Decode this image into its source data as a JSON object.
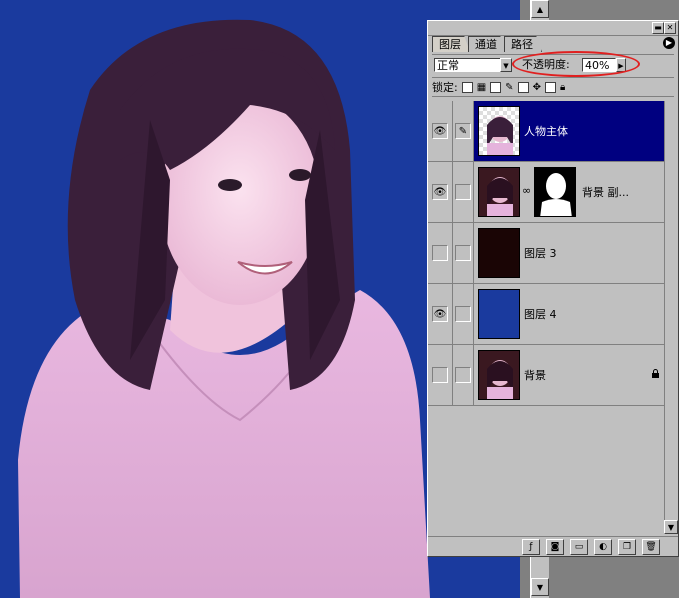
{
  "layers_panel": {
    "tabs": [
      {
        "label": "图层",
        "active": true
      },
      {
        "label": "通道",
        "active": false
      },
      {
        "label": "路径",
        "active": false
      }
    ],
    "blend_mode": "正常",
    "opacity_label": "不透明度:",
    "opacity_value": "40%",
    "lock_label": "锁定:",
    "layers": [
      {
        "name": "人物主体",
        "visible": true,
        "selected": true,
        "has_mask": false,
        "locked": false,
        "thumb": "person-transparent"
      },
      {
        "name": "背景 副...",
        "visible": true,
        "selected": false,
        "has_mask": true,
        "locked": false,
        "thumb": "person"
      },
      {
        "name": "图层 3",
        "visible": false,
        "selected": false,
        "has_mask": false,
        "locked": false,
        "thumb": "dark"
      },
      {
        "name": "图层 4",
        "visible": true,
        "selected": false,
        "has_mask": false,
        "locked": false,
        "thumb": "blue"
      },
      {
        "name": "背景",
        "visible": false,
        "selected": false,
        "has_mask": false,
        "locked": true,
        "thumb": "person"
      }
    ]
  },
  "colors": {
    "canvas_background": "#1a3a9e",
    "selection_highlight": "#000080",
    "annotation_ellipse": "#e02020",
    "layer3_fill": "#1a0505",
    "layer4_fill": "#1a3a9e"
  }
}
